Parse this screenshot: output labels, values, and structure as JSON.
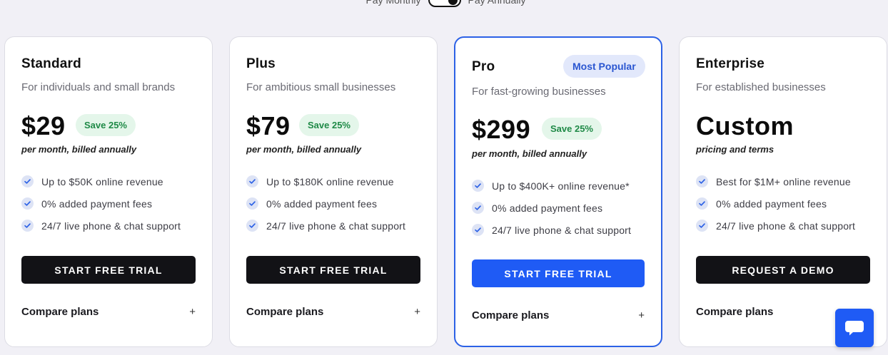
{
  "billing_toggle": {
    "left_label": "Pay Monthly",
    "right_label": "Pay Annually",
    "selected": "annually"
  },
  "plans": [
    {
      "name": "Standard",
      "description": "For individuals and small brands",
      "price": "$29",
      "badge": "Save 25%",
      "billing": "per month, billed annually",
      "features": [
        "Up to $50K online revenue",
        "0% added payment fees",
        "24/7 live phone & chat support"
      ],
      "cta": "START FREE TRIAL",
      "compare": "Compare plans",
      "compare_icon": "+"
    },
    {
      "name": "Plus",
      "description": "For ambitious small businesses",
      "price": "$79",
      "badge": "Save 25%",
      "billing": "per month, billed annually",
      "features": [
        "Up to $180K online revenue",
        "0% added payment fees",
        "24/7 live phone & chat support"
      ],
      "cta": "START FREE TRIAL",
      "compare": "Compare plans",
      "compare_icon": "+"
    },
    {
      "name": "Pro",
      "tag": "Most Popular",
      "description": "For fast-growing businesses",
      "price": "$299",
      "badge": "Save 25%",
      "billing": "per month, billed annually",
      "features": [
        "Up to $400K+ online revenue*",
        "0% added payment fees",
        "24/7 live phone & chat support"
      ],
      "cta": "START FREE TRIAL",
      "compare": "Compare plans",
      "compare_icon": "+"
    },
    {
      "name": "Enterprise",
      "description": "For established businesses",
      "price": "Custom",
      "billing": "pricing and terms",
      "features": [
        "Best for $1M+ online revenue",
        "0% added payment fees",
        "24/7 live phone & chat support"
      ],
      "cta": "REQUEST A DEMO",
      "compare": "Compare plans"
    }
  ],
  "colors": {
    "accent_blue": "#1f5bf5",
    "pro_border": "#2c61e6",
    "save_badge_bg": "#e4f6ea",
    "save_badge_text": "#1f8a47",
    "cta_dark": "#121216"
  },
  "icons": {
    "feature_check": "check-circle-icon",
    "chat": "chat-bubble-icon"
  }
}
